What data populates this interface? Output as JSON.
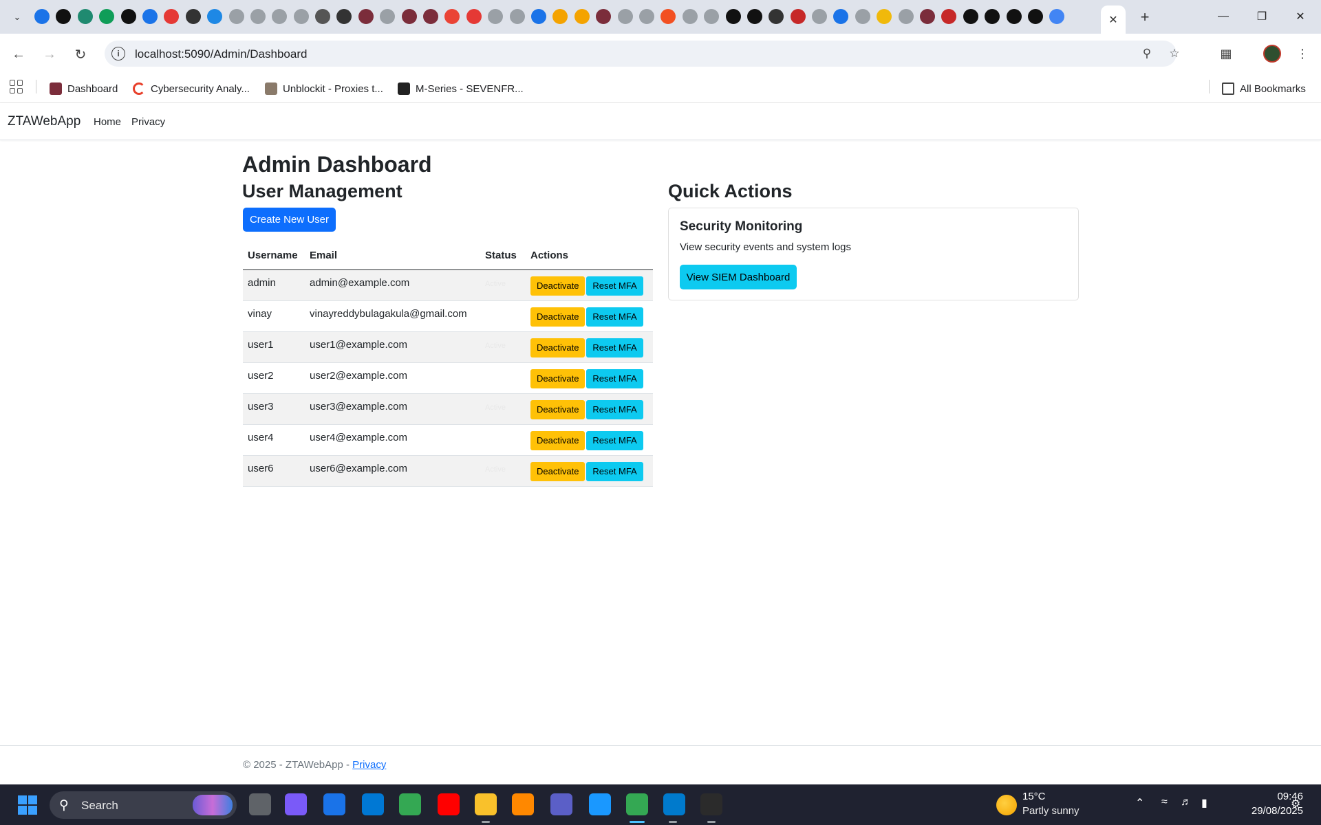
{
  "browser": {
    "url": "localhost:5090/Admin/Dashboard",
    "active_tab_close": "✕",
    "new_tab": "+",
    "bookmarks": [
      {
        "label": "Dashboard",
        "color": "#7b2d3b"
      },
      {
        "label": "Cybersecurity Analy...",
        "color": "#e8412c"
      },
      {
        "label": "Unblockit - Proxies t...",
        "color": "#8a7a6a"
      },
      {
        "label": "M-Series - SEVENFR...",
        "color": "#222222"
      }
    ],
    "all_bookmarks": "All Bookmarks",
    "tab_favicons": [
      "#1a73e8",
      "#111111",
      "#1f8a70",
      "#0f9d58",
      "#111111",
      "#1a73e8",
      "#e53935",
      "#333333",
      "#1e88e5",
      "#9aa0a6",
      "#9aa0a6",
      "#9aa0a6",
      "#9aa0a6",
      "#555555",
      "#333333",
      "#7b2d3b",
      "#9aa0a6",
      "#7b2d3b",
      "#7b2d3b",
      "#ea4335",
      "#e53935",
      "#9aa0a6",
      "#9aa0a6",
      "#1a73e8",
      "#f4a300",
      "#f4a300",
      "#7b2d3b",
      "#9aa0a6",
      "#9aa0a6",
      "#f25022",
      "#9aa0a6",
      "#9aa0a6",
      "#111111",
      "#111111",
      "#333333",
      "#c62828",
      "#9aa0a6",
      "#1a73e8",
      "#9aa0a6",
      "#f0b90b",
      "#9aa0a6",
      "#7b2d3b",
      "#c62828",
      "#111111",
      "#111111",
      "#111111",
      "#111111",
      "#4285f4"
    ]
  },
  "app": {
    "brand": "ZTAWebApp",
    "nav": [
      "Home",
      "Privacy"
    ],
    "page_title": "Admin Dashboard",
    "user_mgmt": {
      "heading": "User Management",
      "create_button": "Create New User",
      "columns": [
        "Username",
        "Email",
        "Status",
        "Actions"
      ],
      "rows": [
        {
          "username": "admin",
          "email": "admin@example.com",
          "status": "Active"
        },
        {
          "username": "vinay",
          "email": "vinayreddybulagakula@gmail.com",
          "status": ""
        },
        {
          "username": "user1",
          "email": "user1@example.com",
          "status": "Active"
        },
        {
          "username": "user2",
          "email": "user2@example.com",
          "status": ""
        },
        {
          "username": "user3",
          "email": "user3@example.com",
          "status": "Active"
        },
        {
          "username": "user4",
          "email": "user4@example.com",
          "status": ""
        },
        {
          "username": "user6",
          "email": "user6@example.com",
          "status": "Active"
        }
      ],
      "deactivate_label": "Deactivate",
      "reset_mfa_label": "Reset MFA"
    },
    "quick_actions": {
      "heading": "Quick Actions",
      "card_title": "Security Monitoring",
      "card_text": "View security events and system logs",
      "card_button": "View SIEM Dashboard"
    },
    "footer": {
      "text": "© 2025 - ZTAWebApp - ",
      "link": "Privacy"
    }
  },
  "taskbar": {
    "search_label": "Search",
    "weather_temp": "15°C",
    "weather_desc": "Partly sunny",
    "time": "09:46",
    "date": "29/08/2025",
    "apps": [
      {
        "name": "task-view",
        "color": "#5f6368"
      },
      {
        "name": "copilot",
        "color": "#7a5af8"
      },
      {
        "name": "store",
        "color": "#1a73e8"
      },
      {
        "name": "azure",
        "color": "#0078d4"
      },
      {
        "name": "chrome",
        "color": "#34a853"
      },
      {
        "name": "youtube",
        "color": "#ff0000"
      },
      {
        "name": "file-explorer",
        "color": "#f9c12b"
      },
      {
        "name": "vlc",
        "color": "#ff8800"
      },
      {
        "name": "teams",
        "color": "#5b5fc7"
      },
      {
        "name": "prime-video",
        "color": "#1a98ff"
      },
      {
        "name": "chrome-active",
        "color": "#34a853"
      },
      {
        "name": "vscode",
        "color": "#007acc"
      },
      {
        "name": "terminal",
        "color": "#2b2b2b"
      }
    ]
  }
}
